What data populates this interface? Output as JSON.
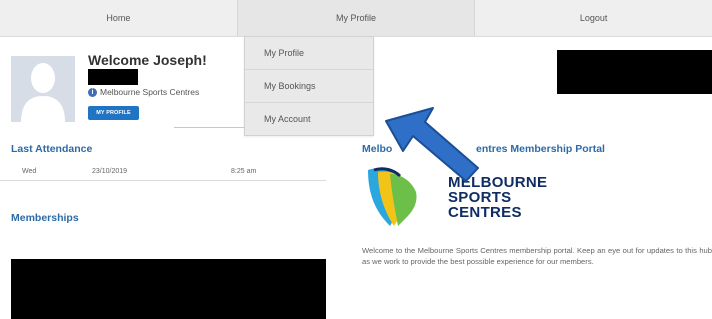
{
  "nav": {
    "home": "Home",
    "my_profile": "My Profile",
    "logout": "Logout"
  },
  "dropdown": [
    "My Profile",
    "My Bookings",
    "My Account"
  ],
  "profile": {
    "welcome": "Welcome Joseph!",
    "org": "Melbourne Sports Centres",
    "button": "MY PROFILE"
  },
  "icons": {
    "info": "info-icon",
    "avatar": "avatar-placeholder",
    "arrow": "blue-arrow-pointer"
  },
  "last_attendance": {
    "title": "Last Attendance",
    "day": "Wed",
    "date": "23/10/2019",
    "time": "8:25 am"
  },
  "memberships": {
    "title": "Memberships"
  },
  "portal": {
    "title_left": "Melbo",
    "title_right": "entres Membership Portal",
    "logo_line1": "MELBOURNE",
    "logo_line2": "SPORTS",
    "logo_line3": "CENTRES",
    "description": "Welcome to the Melbourne Sports Centres membership portal. Keep an eye out for updates to this hub as we work to provide the best possible experience for our members."
  },
  "colors": {
    "accent": "#1f74c4",
    "heading": "#2d6aa8",
    "nav_bg": "#efefef",
    "arrow": "#2f6fc7"
  }
}
